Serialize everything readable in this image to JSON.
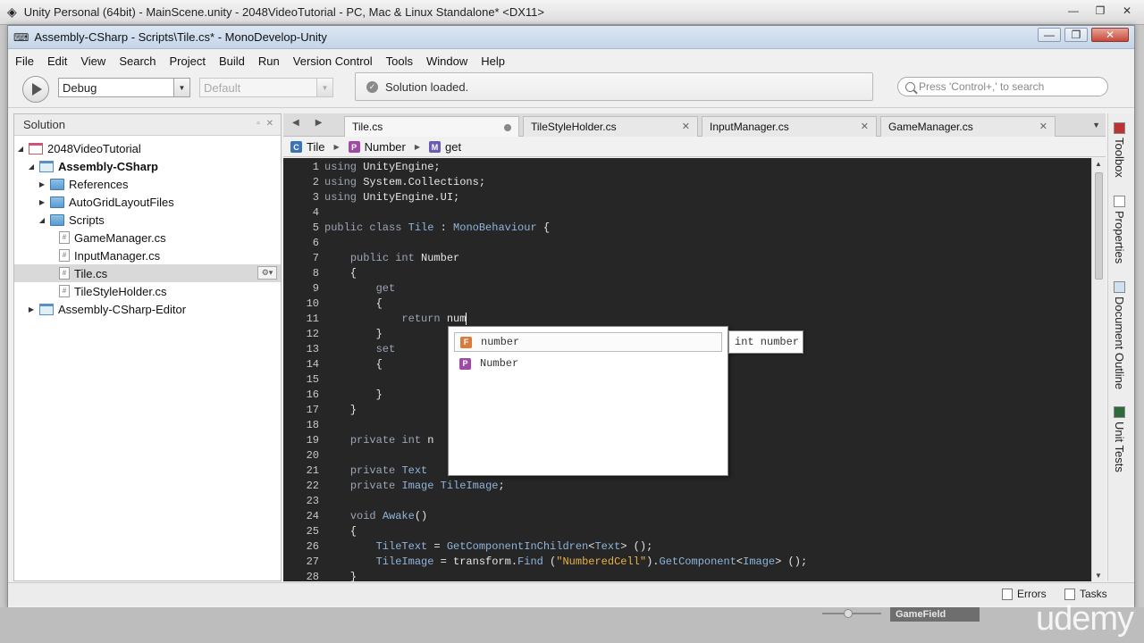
{
  "unity": {
    "title": "Unity Personal (64bit) - MainScene.unity - 2048VideoTutorial - PC, Mac & Linux Standalone* <DX11>",
    "bottom_panel_label": "GameField",
    "watermark": "udemy"
  },
  "window": {
    "title": "Assembly-CSharp - Scripts\\Tile.cs* - MonoDevelop-Unity"
  },
  "menu": [
    "File",
    "Edit",
    "View",
    "Search",
    "Project",
    "Build",
    "Run",
    "Version Control",
    "Tools",
    "Window",
    "Help"
  ],
  "toolbar": {
    "config": "Debug",
    "platform": "Default",
    "status": "Solution loaded.",
    "search_placeholder": "Press 'Control+,' to search"
  },
  "solution": {
    "title": "Solution",
    "items": [
      {
        "label": "2048VideoTutorial"
      },
      {
        "label": "Assembly-CSharp"
      },
      {
        "label": "References"
      },
      {
        "label": "AutoGridLayoutFiles"
      },
      {
        "label": "Scripts"
      },
      {
        "label": "GameManager.cs"
      },
      {
        "label": "InputManager.cs"
      },
      {
        "label": "Tile.cs"
      },
      {
        "label": "TileStyleHolder.cs"
      },
      {
        "label": "Assembly-CSharp-Editor"
      }
    ]
  },
  "tabs": [
    {
      "label": "Tile.cs"
    },
    {
      "label": "TileStyleHolder.cs"
    },
    {
      "label": "InputManager.cs"
    },
    {
      "label": "GameManager.cs"
    }
  ],
  "breadcrumb": {
    "class": "Tile",
    "property": "Number",
    "accessor": "get"
  },
  "code_lines": [
    "1",
    "2",
    "3",
    "4",
    "5",
    "6",
    "7",
    "8",
    "9",
    "10",
    "11",
    "12",
    "13",
    "14",
    "15",
    "16",
    "17",
    "18",
    "19",
    "20",
    "21",
    "22",
    "23",
    "24",
    "25",
    "26",
    "27",
    "28"
  ],
  "completion": {
    "items": [
      "number",
      "Number"
    ],
    "tooltip": "int number"
  },
  "dock": {
    "toolbox": "Toolbox",
    "properties": "Properties",
    "outline": "Document Outline",
    "tests": "Unit Tests"
  },
  "statusbar": {
    "errors": "Errors",
    "tasks": "Tasks"
  }
}
